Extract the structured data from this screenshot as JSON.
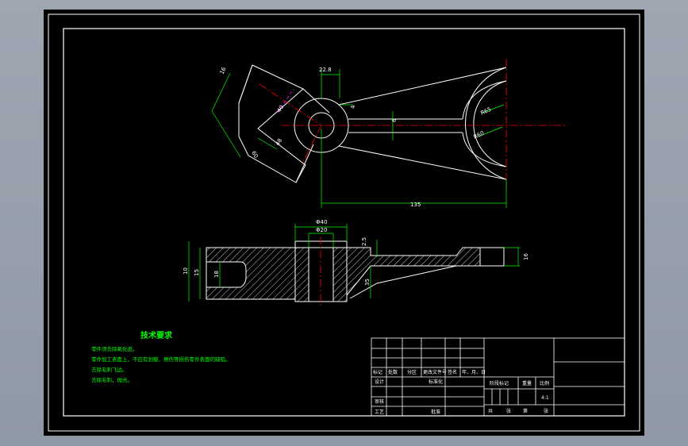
{
  "drawing": {
    "dimensions": {
      "width_16": "16",
      "d22": "22.8",
      "w6": "6",
      "r4": "4",
      "r65": "R65",
      "r60": "R60",
      "d40": "40",
      "d60": "60",
      "d48": "48",
      "d8": "8",
      "len135": "135",
      "phi40": "Φ40",
      "phi20": "Φ20",
      "d25": "2.5",
      "h10": "10",
      "h15": "15",
      "h18": "18",
      "h35": "35",
      "h16": "16"
    },
    "tech_requirements": {
      "title": "技术要求",
      "items": [
        "零件须去除氧化皮。",
        "零件加工表面上，不应有划痕、擦伤等损伤零件表面的缺陷。",
        "去除毛刺飞边。",
        "去除毛刺，抛光。"
      ]
    },
    "title_block": {
      "col_headers": [
        "标记",
        "处数",
        "分区",
        "更改文件号",
        "签名",
        "年、月、日"
      ],
      "design": "设计",
      "standardize": "标准化",
      "stage_mark": "阶段标记",
      "weight": "重量",
      "scale": "比例",
      "scale_value": "4:1",
      "review": "审核",
      "process": "工艺",
      "approve": "批准",
      "sheets_total": "共",
      "sheets_of": "张",
      "sheet_no": "第",
      "sheet_unit": "张"
    },
    "colors": {
      "background": "#000000",
      "outline": "#ffffff",
      "dimension": "#00ff00",
      "centerline": "#ff0000",
      "hidden": "#ff00ff",
      "note_text": "#00ff00"
    }
  }
}
